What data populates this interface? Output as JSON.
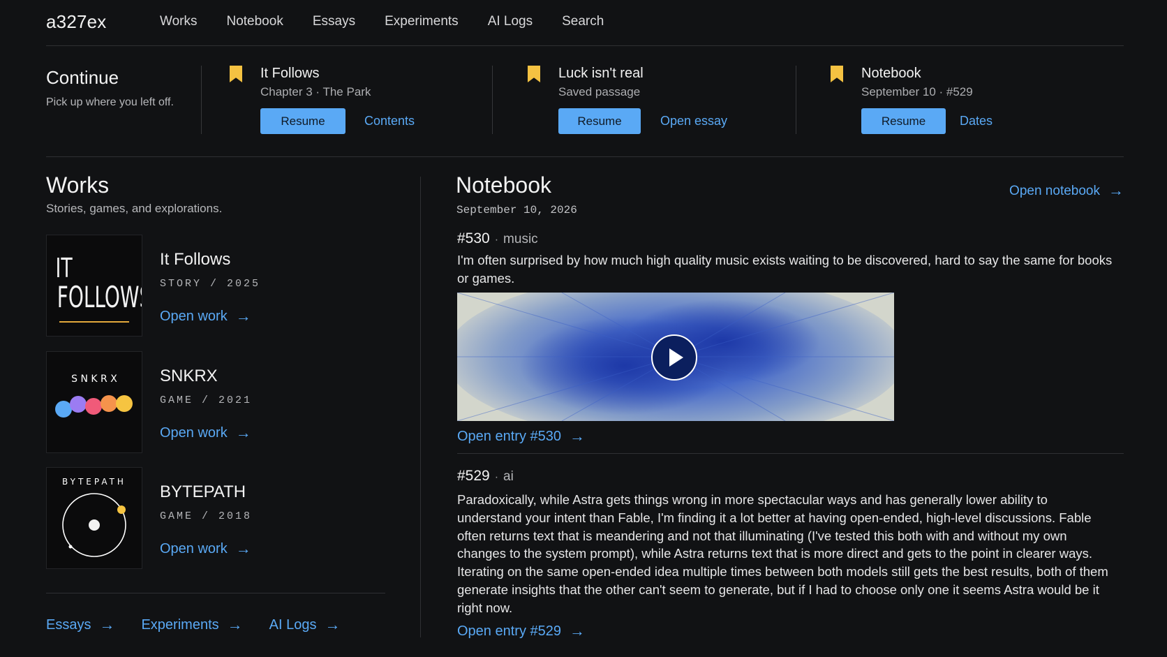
{
  "brand": "a327ex",
  "nav": [
    "Works",
    "Notebook",
    "Essays",
    "Experiments",
    "AI Logs",
    "Search"
  ],
  "continue": {
    "title": "Continue",
    "subtitle": "Pick up where you left off.",
    "cards": [
      {
        "title": "It Follows",
        "subtitle": "Chapter 3 · The Park",
        "button": "Resume",
        "link": "Contents"
      },
      {
        "title": "Luck isn't real",
        "subtitle": "Saved passage",
        "button": "Resume",
        "link": "Open essay"
      },
      {
        "title": "Notebook",
        "subtitle": "September 10 · #529",
        "button": "Resume",
        "link": "Dates"
      }
    ]
  },
  "works": {
    "title": "Works",
    "subtitle": "Stories, games, and explorations.",
    "items": [
      {
        "title": "It Follows",
        "meta": "STORY / 2025",
        "link": "Open work",
        "cover_line1": "IT",
        "cover_line2": "FOLLOWS"
      },
      {
        "title": "SNKRX",
        "meta": "GAME / 2021",
        "link": "Open work",
        "cover_text": "S N K R X"
      },
      {
        "title": "BYTEPATH",
        "meta": "GAME / 2018",
        "link": "Open work",
        "cover_text": "BYTEPATH"
      }
    ],
    "bottom_links": [
      "Essays",
      "Experiments",
      "AI Logs"
    ]
  },
  "notebook": {
    "title": "Notebook",
    "date": "September 10, 2026",
    "open_link": "Open notebook",
    "entries": [
      {
        "number": "#530",
        "tag": "music",
        "text": "I'm often surprised by how much high quality music exists waiting to be discovered, hard to say the same for books or games.",
        "link": "Open entry #530"
      },
      {
        "number": "#529",
        "tag": "ai",
        "text": "Paradoxically, while Astra gets things wrong in more spectacular ways and has generally lower ability to understand your intent than Fable, I'm finding it a lot better at having open-ended, high-level discussions. Fable often returns text that is meandering and not that illuminating (I've tested this both with and without my own changes to the system prompt), while Astra returns text that is more direct and gets to the point in clearer ways. Iterating on the same open-ended idea multiple times between both models still gets the best results, both of them generate insights that the other can't seem to generate, but if I had to choose only one it seems Astra would be it right now.",
        "link": "Open entry #529"
      }
    ]
  },
  "colors": {
    "accent": "#5aa9f5",
    "bookmark": "#f5c242",
    "background": "#111214"
  },
  "icons": {
    "bookmark": "bookmark-icon",
    "arrow": "arrow-right-icon",
    "play": "play-icon"
  }
}
